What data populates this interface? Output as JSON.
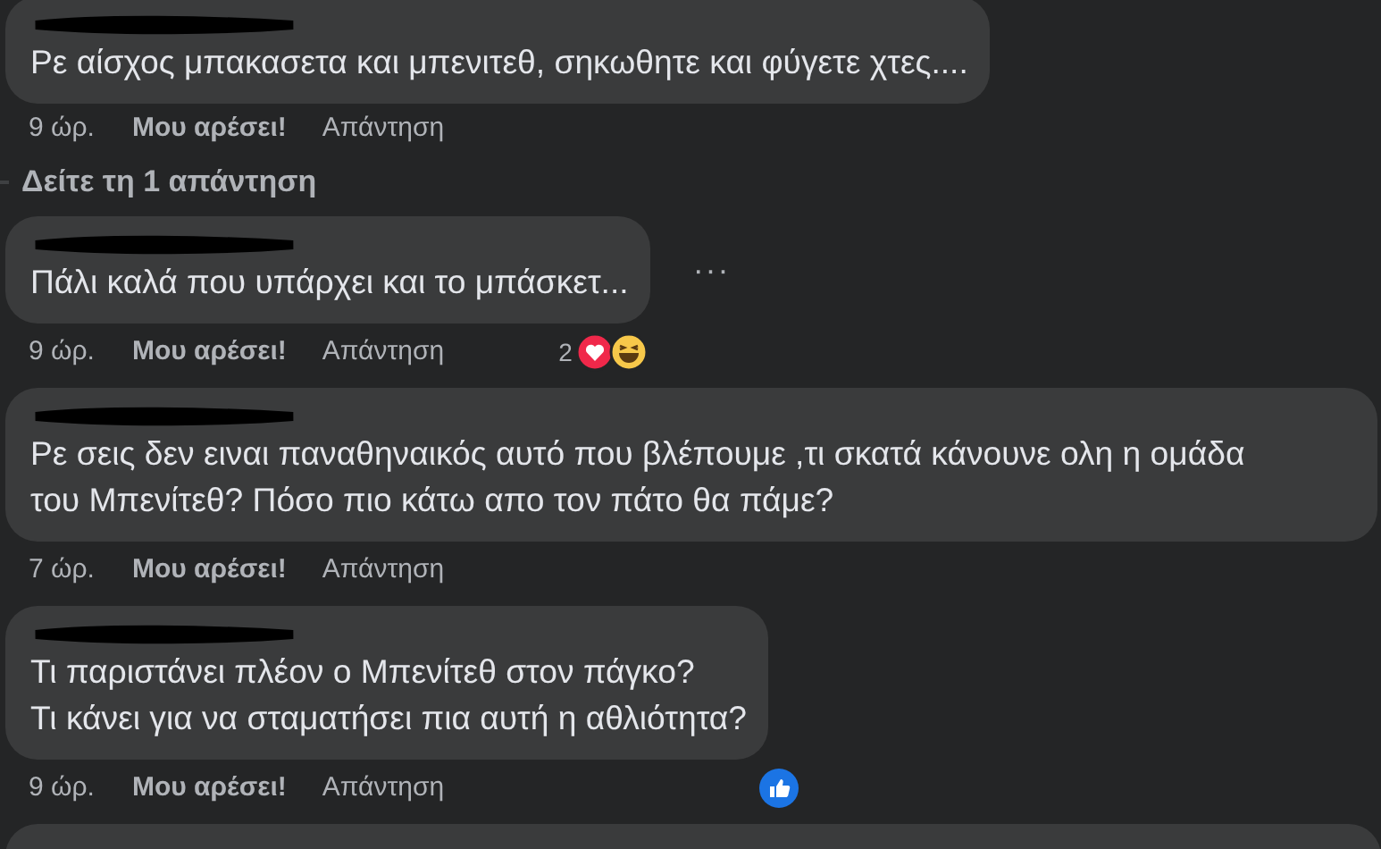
{
  "comments": [
    {
      "lines": [
        "Ρε αίσχος μπακασετα και μπενιτεθ, σηκωθητε και φύγετε χτες...."
      ],
      "time": "9 ώρ.",
      "like": "Μου αρέσει!",
      "reply": "Απάντηση",
      "replies_link": "Δείτε τη 1 απάντηση"
    },
    {
      "lines": [
        "Πάλι καλά που υπάρχει και το μπάσκετ..."
      ],
      "time": "9 ώρ.",
      "like": "Μου αρέσει!",
      "reply": "Απάντηση",
      "more": "···",
      "reaction_count": "2",
      "reactions": [
        {
          "kind": "love"
        },
        {
          "kind": "haha"
        }
      ]
    },
    {
      "lines": [
        "Ρε σεις δεν ειναι παναθηναικός αυτό που βλέπουμε ,τι σκατά κάνουνε ολη η ομάδα",
        "του Μπενίτεθ? Πόσο πιο κάτω απο τον πάτο θα πάμε?"
      ],
      "time": "7 ώρ.",
      "like": "Μου αρέσει!",
      "reply": "Απάντηση"
    },
    {
      "lines": [
        "Τι παριστάνει πλέον ο Μπενίτεθ στον πάγκο?",
        "Τι κάνει για να σταματήσει πια αυτή η αθλιότητα?"
      ],
      "time": "9 ώρ.",
      "like": "Μου αρέσει!",
      "reply": "Απάντηση",
      "reactions": [
        {
          "kind": "like"
        }
      ]
    }
  ]
}
